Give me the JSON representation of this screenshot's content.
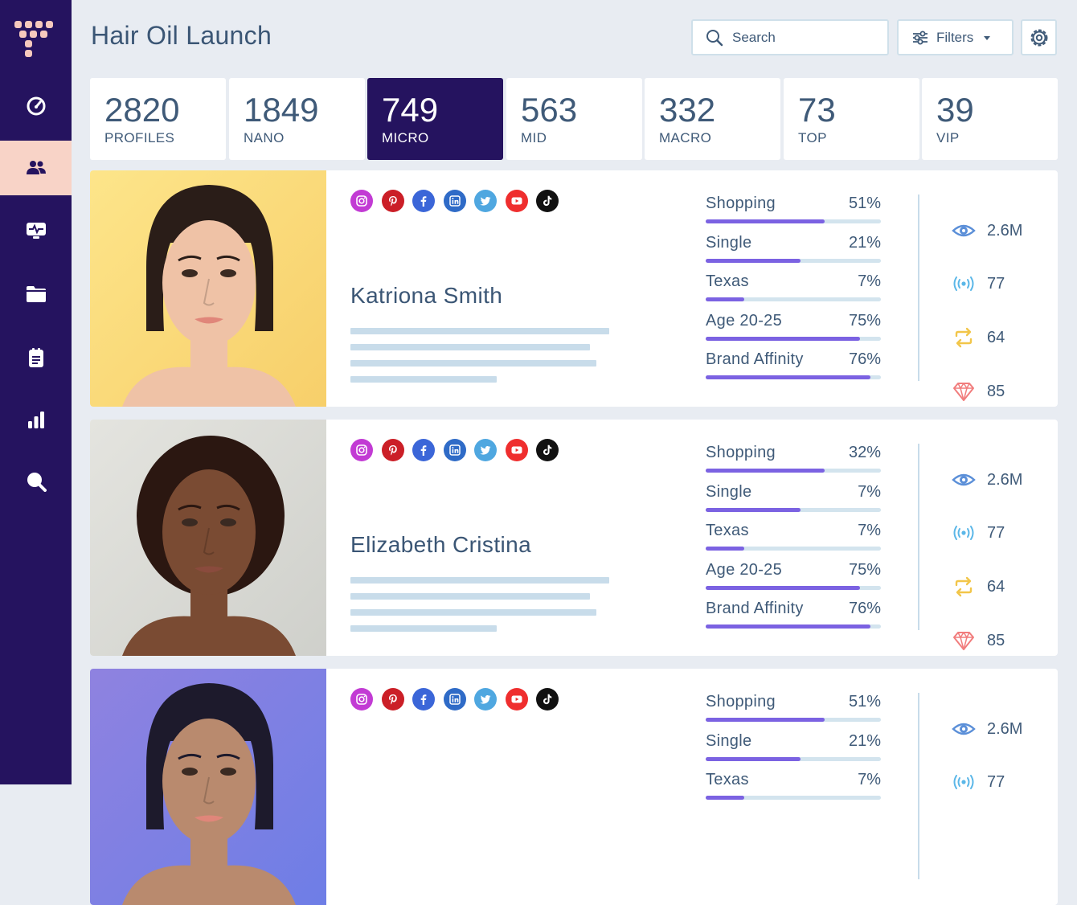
{
  "page": {
    "title": "Hair Oil Launch"
  },
  "header": {
    "search_placeholder": "Search",
    "filters_label": "Filters"
  },
  "sidebar": {
    "items": [
      {
        "icon": "dashboard-gauge-icon",
        "active": false
      },
      {
        "icon": "users-icon",
        "active": true
      },
      {
        "icon": "monitor-pulse-icon",
        "active": false
      },
      {
        "icon": "folder-icon",
        "active": false
      },
      {
        "icon": "clipboard-icon",
        "active": false
      },
      {
        "icon": "bar-chart-icon",
        "active": false
      },
      {
        "icon": "search-icon",
        "active": false
      }
    ]
  },
  "tiers": [
    {
      "count": "2820",
      "label": "PROFILES",
      "active": false
    },
    {
      "count": "1849",
      "label": "NANO",
      "active": false
    },
    {
      "count": "749",
      "label": "MICRO",
      "active": true
    },
    {
      "count": "563",
      "label": "MID",
      "active": false
    },
    {
      "count": "332",
      "label": "MACRO",
      "active": false
    },
    {
      "count": "73",
      "label": "TOP",
      "active": false
    },
    {
      "count": "39",
      "label": "VIP",
      "active": false
    }
  ],
  "social_networks": [
    "instagram",
    "pinterest",
    "facebook",
    "linkedin",
    "twitter",
    "youtube",
    "tiktok"
  ],
  "colors": {
    "sidebar": "#25135f",
    "accent": "#7b62e2",
    "active_nav": "#f8d3c7",
    "instagram": "#c23bd4",
    "pinterest": "#cb1f27",
    "facebook": "#3b66d8",
    "linkedin": "#2f6bc7",
    "twitter": "#4fa7e0",
    "youtube": "#ef2e2e",
    "tiktok": "#111111"
  },
  "profiles": [
    {
      "name": "Katriona Smith",
      "metrics": [
        {
          "label": "Shopping",
          "value": "51%",
          "fill": 0.68
        },
        {
          "label": "Single",
          "value": "21%",
          "fill": 0.54
        },
        {
          "label": "Texas",
          "value": "7%",
          "fill": 0.22
        },
        {
          "label": "Age 20-25",
          "value": "75%",
          "fill": 0.88
        },
        {
          "label": "Brand Affinity",
          "value": "76%",
          "fill": 0.94
        }
      ],
      "stats": {
        "views": "2.6M",
        "reach": "77",
        "shares": "64",
        "value": "85"
      }
    },
    {
      "name": "Elizabeth Cristina",
      "metrics": [
        {
          "label": "Shopping",
          "value": "32%",
          "fill": 0.68
        },
        {
          "label": "Single",
          "value": "7%",
          "fill": 0.54
        },
        {
          "label": "Texas",
          "value": "7%",
          "fill": 0.22
        },
        {
          "label": "Age 20-25",
          "value": "75%",
          "fill": 0.88
        },
        {
          "label": "Brand Affinity",
          "value": "76%",
          "fill": 0.94
        }
      ],
      "stats": {
        "views": "2.6M",
        "reach": "77",
        "shares": "64",
        "value": "85"
      }
    },
    {
      "name": "",
      "metrics": [
        {
          "label": "Shopping",
          "value": "51%",
          "fill": 0.68
        },
        {
          "label": "Single",
          "value": "21%",
          "fill": 0.54
        },
        {
          "label": "Texas",
          "value": "7%",
          "fill": 0.22
        }
      ],
      "stats": {
        "views": "2.6M",
        "reach": "77"
      }
    }
  ]
}
